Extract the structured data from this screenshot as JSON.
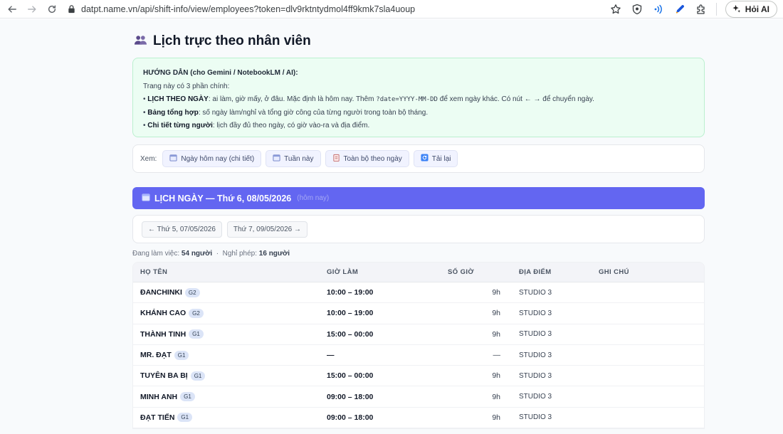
{
  "browser": {
    "url": "datpt.name.vn/api/shift-info/view/employees?token=dlv9rktntydmol4ff9kmk7sla4uoup",
    "ai_button": "Hỏi AI"
  },
  "page": {
    "title": "Lịch trực theo nhân viên",
    "guide": {
      "title": "HƯỚNG DẪN (cho Gemini / NotebookLM / AI):",
      "intro": "Trang này có 3 phần chính:",
      "item1_bold": "LỊCH THEO NGÀY",
      "item1_text": ": ai làm, giờ mấy, ở đâu. Mặc định là hôm nay. Thêm ",
      "item1_code": "?date=YYYY-MM-DD",
      "item1_text2": " để xem ngày khác. Có nút ← → để chuyển ngày.",
      "item2_bold": "Bảng tổng hợp",
      "item2_text": ": số ngày làm/nghỉ và tổng giờ công của từng người trong toàn bộ tháng.",
      "item3_bold": "Chi tiết từng người",
      "item3_text": ": lịch đầy đủ theo ngày, có giờ vào-ra và địa điểm."
    },
    "view": {
      "label": "Xem:",
      "buttons": [
        "Ngày hôm nay (chi tiết)",
        "Tuần này",
        "Toàn bộ theo ngày",
        "Tải lại"
      ]
    },
    "day_header": {
      "title": "LỊCH NGÀY — Thứ 6, 08/05/2026",
      "tag": "(hôm nay)"
    },
    "nav": {
      "prev": "← Thứ 5, 07/05/2026",
      "next": "Thứ 7, 09/05/2026 →"
    },
    "summary": {
      "working_label": "Đang làm việc:",
      "working_value": "54 người",
      "dot": "·",
      "leave_label": "Nghỉ phép:",
      "leave_value": "16 người"
    },
    "table": {
      "headers": [
        "HỌ TÊN",
        "GIỜ LÀM",
        "SỐ GIỜ",
        "ĐỊA ĐIỂM",
        "GHI CHÚ"
      ],
      "rows": [
        {
          "name": "ĐANCHINKI",
          "group": "G2",
          "time": "10:00 – 19:00",
          "hours": "9h",
          "location": "STUDIO 3",
          "note": ""
        },
        {
          "name": "KHÁNH CAO",
          "group": "G2",
          "time": "10:00 – 19:00",
          "hours": "9h",
          "location": "STUDIO 3",
          "note": ""
        },
        {
          "name": "THÀNH TINH",
          "group": "G1",
          "time": "15:00 – 00:00",
          "hours": "9h",
          "location": "STUDIO 3",
          "note": ""
        },
        {
          "name": "MR. ĐẠT",
          "group": "G1",
          "time": "—",
          "hours": "—",
          "location": "STUDIO 3",
          "note": ""
        },
        {
          "name": "TUYÊN BA BỊ",
          "group": "G1",
          "time": "15:00 – 00:00",
          "hours": "9h",
          "location": "STUDIO 3",
          "note": ""
        },
        {
          "name": "MINH ANH",
          "group": "G1",
          "time": "09:00 – 18:00",
          "hours": "9h",
          "location": "STUDIO 3",
          "note": ""
        },
        {
          "name": "ĐẠT TIẾN",
          "group": "G1",
          "time": "09:00 – 18:00",
          "hours": "9h",
          "location": "STUDIO 3",
          "note": ""
        }
      ]
    }
  },
  "colors": {
    "accent": "#6366f1",
    "guide_bg": "#ecfdf3",
    "page_bg": "#f8fafc"
  }
}
